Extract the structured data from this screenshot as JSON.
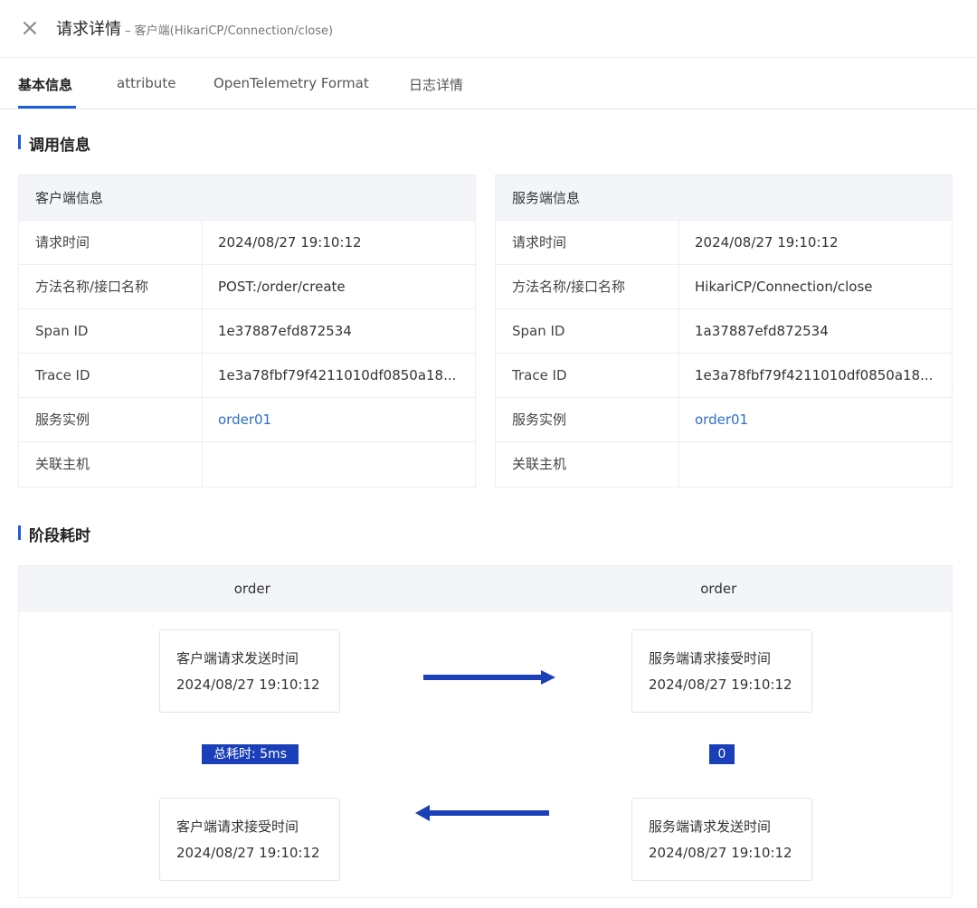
{
  "header": {
    "title": "请求详情",
    "subtitle": "– 客户端(HikariCP/Connection/close)"
  },
  "tabs": [
    {
      "label": "基本信息",
      "active": true
    },
    {
      "label": "attribute"
    },
    {
      "label": "OpenTelemetry Format"
    },
    {
      "label": "日志详情"
    }
  ],
  "call_info": {
    "title": "调用信息",
    "client": {
      "title": "客户端信息",
      "rows": [
        {
          "key": "请求时间",
          "value": "2024/08/27 19:10:12"
        },
        {
          "key": "方法名称/接口名称",
          "value": "POST:/order/create"
        },
        {
          "key": "Span ID",
          "value": "1e37887efd872534"
        },
        {
          "key": "Trace ID",
          "value": "1e3a78fbf79f4211010df0850a18..."
        },
        {
          "key": "服务实例",
          "value": "order01"
        },
        {
          "key": "关联主机",
          "value": ""
        }
      ]
    },
    "server": {
      "title": "服务端信息",
      "rows": [
        {
          "key": "请求时间",
          "value": "2024/08/27 19:10:12"
        },
        {
          "key": "方法名称/接口名称",
          "value": "HikariCP/Connection/close"
        },
        {
          "key": "Span ID",
          "value": "1a37887efd872534"
        },
        {
          "key": "Trace ID",
          "value": "1e3a78fbf79f4211010df0850a18..."
        },
        {
          "key": "服务实例",
          "value": "order01"
        },
        {
          "key": "关联主机",
          "value": ""
        }
      ]
    }
  },
  "stage_timing": {
    "title": "阶段耗时",
    "columns": [
      "order",
      "order"
    ],
    "client_send": {
      "label": "客户端请求发送时间",
      "time": "2024/08/27 19:10:12"
    },
    "server_receive": {
      "label": "服务端请求接受时间",
      "time": "2024/08/27 19:10:12"
    },
    "client_receive": {
      "label": "客户端请求接受时间",
      "time": "2024/08/27 19:10:12"
    },
    "server_send": {
      "label": "服务端请求发送时间",
      "time": "2024/08/27 19:10:12"
    },
    "total_badge": "总耗时: 5ms",
    "server_badge": "0"
  },
  "colors": {
    "accent": "#1e5bd8",
    "arrow": "#1a3fb8",
    "link": "#2c6ecb"
  }
}
